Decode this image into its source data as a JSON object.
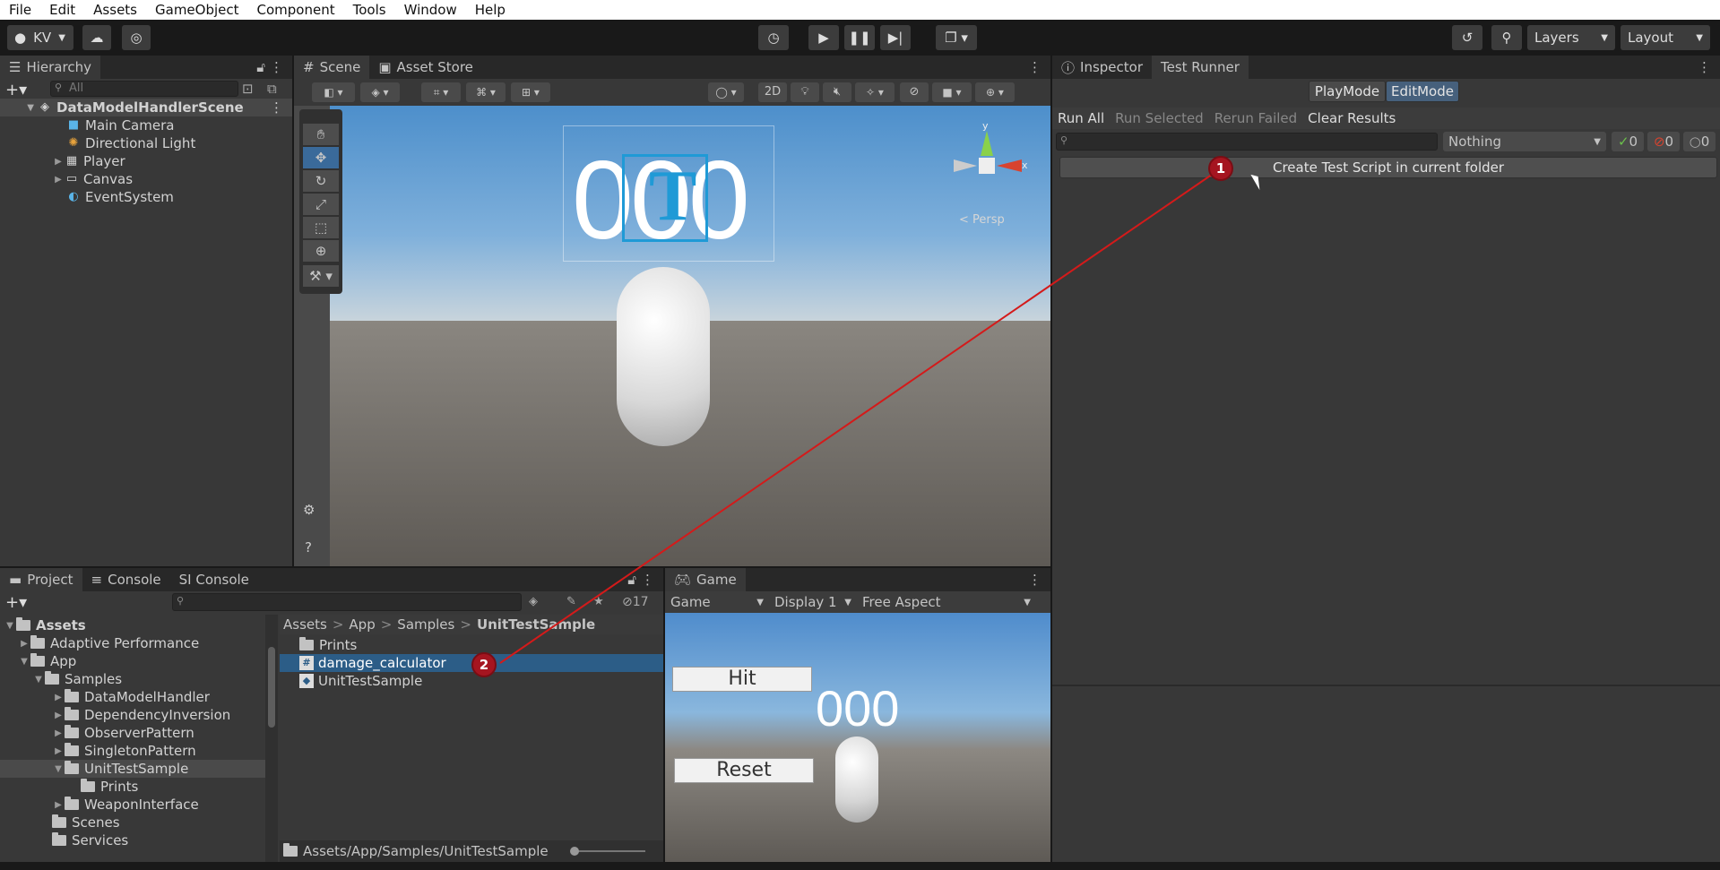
{
  "menu": [
    "File",
    "Edit",
    "Assets",
    "GameObject",
    "Component",
    "Tools",
    "Window",
    "Help"
  ],
  "toolbar": {
    "account": "KV",
    "layers": "Layers",
    "layout": "Layout"
  },
  "hierarchy": {
    "tab": "Hierarchy",
    "search_placeholder": "All",
    "scene": "DataModelHandlerScene",
    "items": [
      "Main Camera",
      "Directional Light",
      "Player",
      "Canvas",
      "EventSystem"
    ]
  },
  "scene_view": {
    "tabs": [
      "Scene",
      "Asset Store"
    ],
    "mode_2d": "2D",
    "persp": "Persp",
    "ui_text": "000",
    "gizmo_y": "y",
    "gizmo_x": "x"
  },
  "inspector": {
    "tabs": [
      "Inspector",
      "Test Runner"
    ]
  },
  "test_runner": {
    "modes": [
      "PlayMode",
      "EditMode"
    ],
    "actions": [
      "Run All",
      "Run Selected",
      "Rerun Failed",
      "Clear Results"
    ],
    "filter": "Nothing",
    "counts": [
      "0",
      "0",
      "0"
    ],
    "create_button": "Create Test Script in current folder"
  },
  "project": {
    "tabs": [
      "Project",
      "Console",
      "SI Console"
    ],
    "hidden_count": "17",
    "tree": [
      {
        "label": "Assets",
        "depth": 0,
        "open": true
      },
      {
        "label": "Adaptive Performance",
        "depth": 1
      },
      {
        "label": "App",
        "depth": 1,
        "open": true
      },
      {
        "label": "Samples",
        "depth": 2,
        "open": true
      },
      {
        "label": "DataModelHandler",
        "depth": 3
      },
      {
        "label": "DependencyInversion",
        "depth": 3
      },
      {
        "label": "ObserverPattern",
        "depth": 3
      },
      {
        "label": "SingletonPattern",
        "depth": 3
      },
      {
        "label": "UnitTestSample",
        "depth": 3,
        "open": true,
        "selected": true
      },
      {
        "label": "Prints",
        "depth": 4
      },
      {
        "label": "WeaponInterface",
        "depth": 3
      },
      {
        "label": "Scenes",
        "depth": 2
      },
      {
        "label": "Services",
        "depth": 2
      }
    ],
    "breadcrumb": [
      "Assets",
      "App",
      "Samples",
      "UnitTestSample"
    ],
    "files": [
      "Prints",
      "damage_calculator",
      "UnitTestSample"
    ],
    "path": "Assets/App/Samples/UnitTestSample"
  },
  "game": {
    "tab": "Game",
    "dropdowns": [
      "Game",
      "Display 1",
      "Free Aspect"
    ],
    "buttons": [
      "Hit",
      "Reset"
    ],
    "score": "000"
  },
  "markers": [
    "1",
    "2"
  ]
}
